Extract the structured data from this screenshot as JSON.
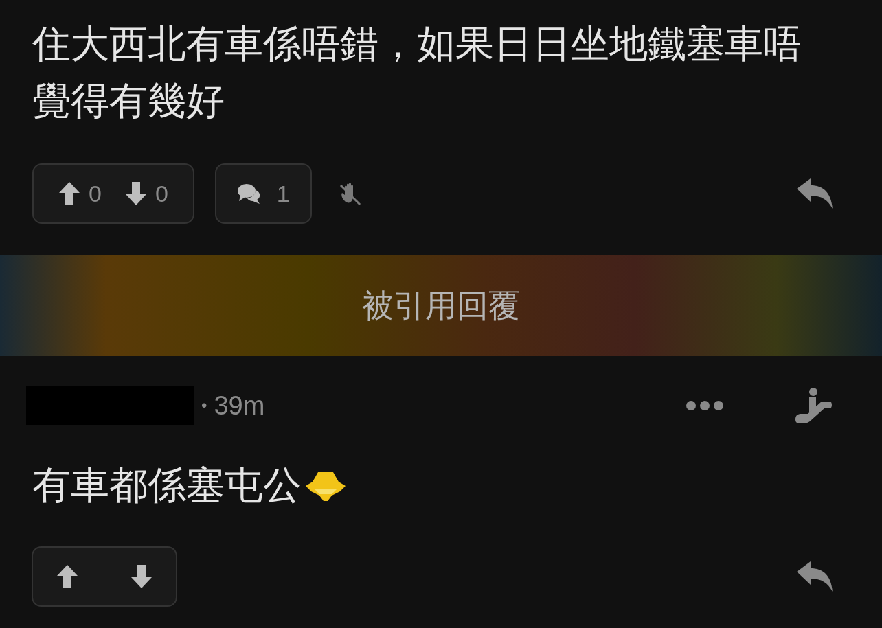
{
  "post": {
    "text": "住大西北有車係唔錯，如果日日坐地鐵塞車唔覺得有幾好",
    "upvotes": "0",
    "downvotes": "0",
    "comments": "1"
  },
  "quote_banner": {
    "label": "被引用回覆"
  },
  "reply": {
    "time": "39m",
    "separator": "•",
    "text": "有車都係塞屯公"
  }
}
